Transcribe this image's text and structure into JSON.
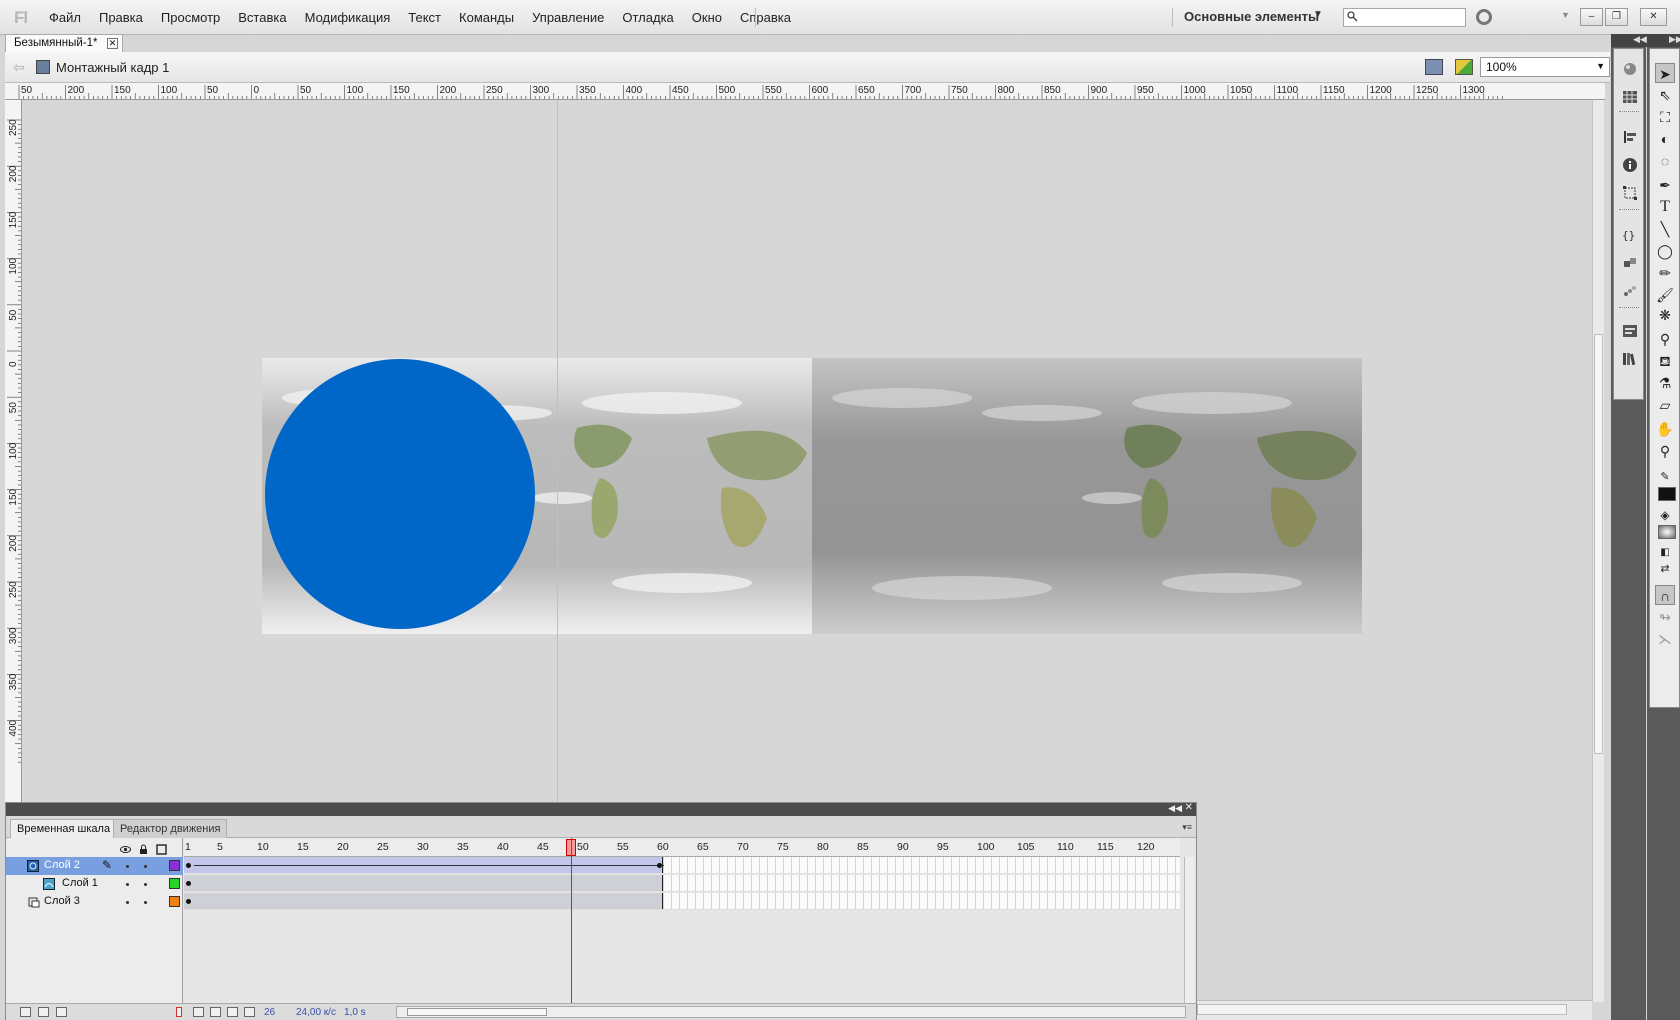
{
  "app": {
    "logo": "Fl",
    "workspace": "Основные элементы"
  },
  "menu": [
    "Файл",
    "Правка",
    "Просмотр",
    "Вставка",
    "Модификация",
    "Текст",
    "Команды",
    "Управление",
    "Отладка",
    "Окно",
    "Справка"
  ],
  "search": {
    "placeholder": ""
  },
  "document": {
    "tab_title": "Безымянный-1*",
    "scene": "Монтажный кадр 1",
    "zoom": "100%"
  },
  "rulers": {
    "horizontal_labels": [
      "50",
      "200",
      "150",
      "100",
      "50",
      "0",
      "50",
      "100",
      "150",
      "200",
      "250",
      "300",
      "350",
      "400",
      "450",
      "500",
      "550",
      "600",
      "650",
      "700",
      "750",
      "800",
      "850",
      "900",
      "950",
      "1000",
      "1050",
      "1100",
      "1150",
      "1200",
      "1250",
      "1300"
    ],
    "vertical_labels": [
      "250",
      "200",
      "150",
      "100",
      "50",
      "0",
      "50",
      "100",
      "150",
      "200",
      "250",
      "300",
      "350",
      "400"
    ]
  },
  "stage": {
    "circle_color": "#0066c8",
    "guide_color": "#6fe3e3",
    "image": "world-cloud-map"
  },
  "timeline": {
    "tabs": [
      "Временная шкала",
      "Редактор движения"
    ],
    "frame_numbers": [
      "1",
      "5",
      "10",
      "15",
      "20",
      "25",
      "30",
      "35",
      "40",
      "45",
      "50",
      "55",
      "60",
      "65",
      "70",
      "75",
      "80",
      "85",
      "90",
      "95",
      "100",
      "105",
      "110",
      "115",
      "120"
    ],
    "current_frame": "26",
    "frame_rate": "24,00 к/с",
    "elapsed": "1,0 s",
    "span_end_frame": 60,
    "layers": [
      {
        "name": "Слой 2",
        "selected": true,
        "color": "#8b2fd6",
        "type": "motion-tween"
      },
      {
        "name": "Слой 1",
        "selected": false,
        "color": "#27d42a",
        "type": "guide"
      },
      {
        "name": "Слой 3",
        "selected": false,
        "color": "#f08010",
        "type": "normal"
      }
    ]
  },
  "tools": [
    "selection",
    "subselection",
    "free-transform",
    "3d-rotation",
    "lasso",
    "pen",
    "text",
    "line",
    "oval",
    "pencil",
    "brush",
    "deco",
    "bone",
    "paint-bucket",
    "eyedropper",
    "eraser",
    "hand",
    "zoom",
    "stroke-color",
    "fill-color",
    "swap-colors",
    "snap-magnet",
    "smooth",
    "straighten"
  ],
  "colors": {
    "stroke": "#111111",
    "fill_gradient": "#888888",
    "accent_selected_layer": "#6f95d8"
  }
}
